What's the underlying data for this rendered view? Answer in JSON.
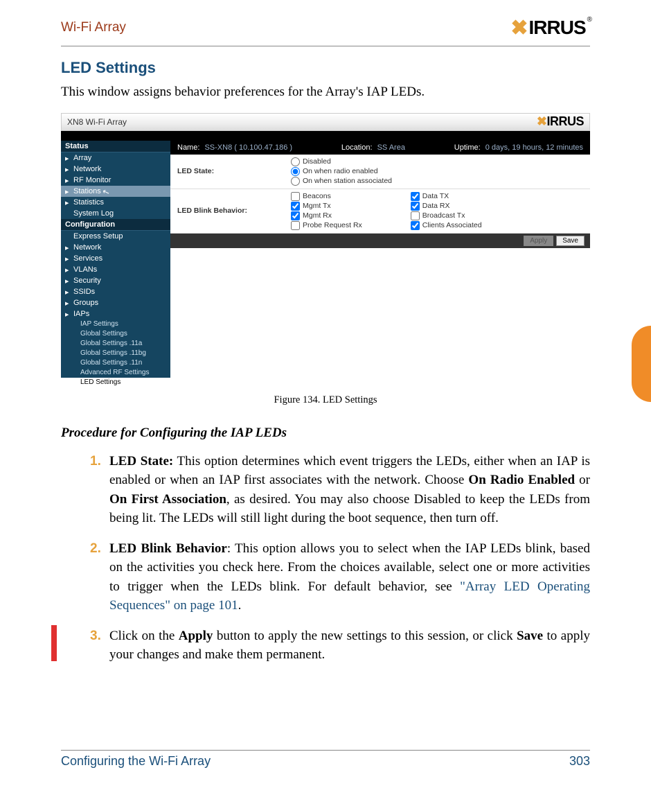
{
  "header": {
    "title": "Wi-Fi Array",
    "brand": "IRRUS"
  },
  "section": {
    "heading": "LED Settings",
    "intro": "This window assigns behavior preferences for the Array's IAP LEDs."
  },
  "shot": {
    "device": "XN8 Wi-Fi Array",
    "brand": "IRRUS",
    "status": {
      "name_lbl": "Name:",
      "name_val": "SS-XN8  ( 10.100.47.186 )",
      "loc_lbl": "Location:",
      "loc_val": "SS Area",
      "up_lbl": "Uptime:",
      "up_val": "0 days, 19 hours, 12 minutes"
    },
    "nav_sect_status": "Status",
    "nav_status": [
      "Array",
      "Network",
      "RF Monitor",
      "Stations",
      "Statistics",
      "System Log"
    ],
    "nav_sect_config": "Configuration",
    "nav_config": [
      "Express Setup",
      "Network",
      "Services",
      "VLANs",
      "Security",
      "SSIDs",
      "Groups",
      "IAPs"
    ],
    "nav_sub": [
      "IAP Settings",
      "Global Settings",
      "Global Settings .11a",
      "Global Settings .11bg",
      "Global Settings .11n",
      "Advanced RF Settings",
      "LED Settings"
    ],
    "form": {
      "led_state_lbl": "LED State:",
      "led_state_opts": [
        "Disabled",
        "On when radio enabled",
        "On when station associated"
      ],
      "led_blink_lbl": "LED Blink Behavior:",
      "blink_left_vals": [
        "Beacons",
        "Mgmt Tx",
        "Mgmt Rx",
        "Probe Request Rx"
      ],
      "blink_right_vals": [
        "Data TX",
        "Data RX",
        "Broadcast Tx",
        "Clients Associated"
      ],
      "apply": "Apply",
      "save": "Save"
    }
  },
  "figure_caption": "Figure 134. LED Settings",
  "procedure_heading": "Procedure for Configuring the IAP LEDs",
  "steps": {
    "s1_num": "1.",
    "s1a": "LED State:",
    "s1b": " This option determines which event triggers the LEDs, either when an IAP is enabled or when an IAP first associates with the network. Choose ",
    "s1c": "On Radio Enabled",
    "s1d": " or ",
    "s1e": "On First Association",
    "s1f": ", as desired. You may also choose Disabled to keep the LEDs from being lit. The LEDs will still light during the boot sequence, then turn off.",
    "s2_num": "2.",
    "s2a": "LED Blink Behavior",
    "s2b": ": This option allows you to select when the IAP LEDs blink, based on the activities you check here. From the choices available, select one or more activities to trigger when the LEDs blink. For default behavior, see ",
    "s2c": "\"Array LED Operating Sequences\" on page 101",
    "s2d": ".",
    "s3_num": "3.",
    "s3a": "Click on the ",
    "s3b": "Apply",
    "s3c": " button to apply the new settings to this session, or click ",
    "s3d": "Save",
    "s3e": " to apply your changes and make them permanent."
  },
  "footer": {
    "left": "Configuring the Wi-Fi Array",
    "right": "303"
  }
}
